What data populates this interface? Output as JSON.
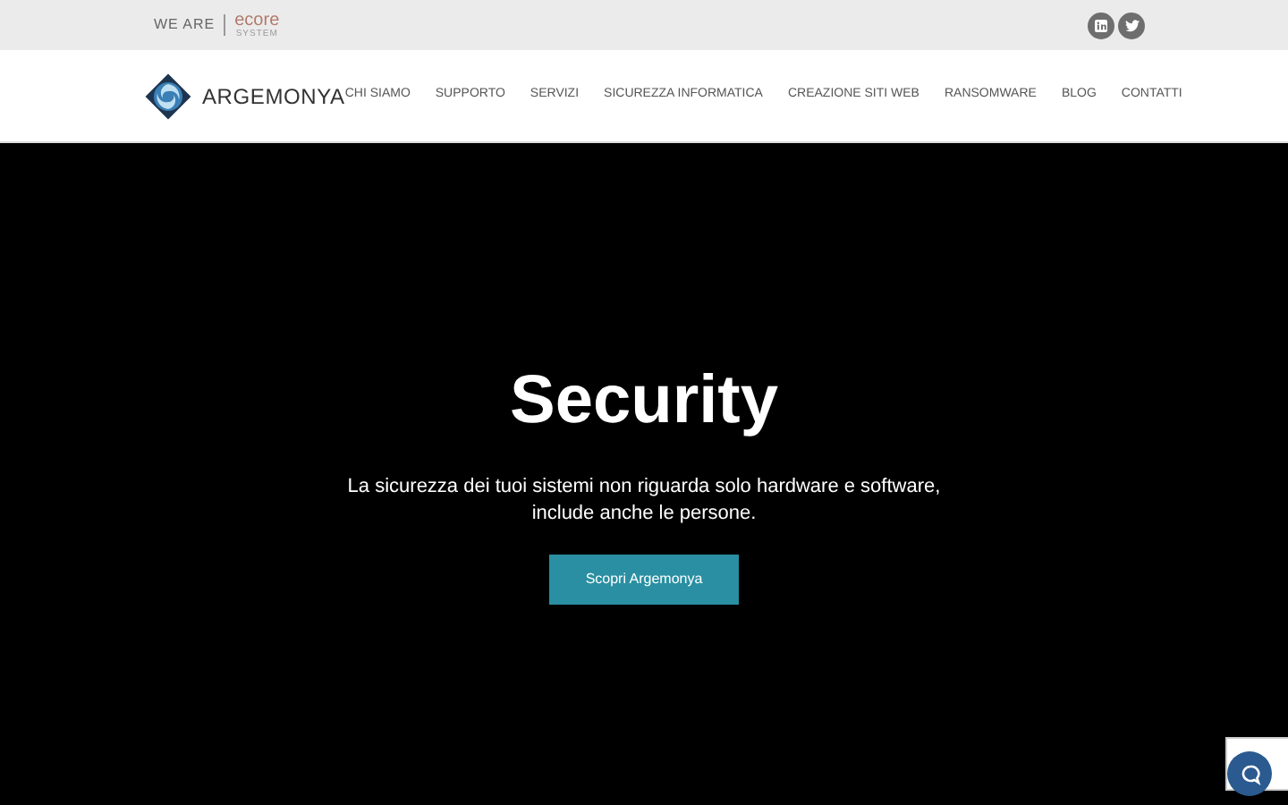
{
  "top_bar": {
    "tagline": "WE ARE",
    "partner_logo": {
      "name": "ecore",
      "subtitle": "SYSTEM"
    }
  },
  "header": {
    "brand": "ARGEMONYA",
    "nav": [
      {
        "label": "CHI SIAMO"
      },
      {
        "label": "SUPPORTO"
      },
      {
        "label": "SERVIZI"
      },
      {
        "label": "SICUREZZA INFORMATICA"
      },
      {
        "label": "CREAZIONE SITI WEB"
      },
      {
        "label": "RANSOMWARE"
      },
      {
        "label": "BLOG"
      },
      {
        "label": "CONTATTI"
      }
    ]
  },
  "hero": {
    "title": "Security",
    "subtitle_lines": [
      "La sicurezza dei tuoi sistemi non riguarda solo hardware e software,",
      "include anche le persone."
    ],
    "button": "Scopri Argemonya"
  }
}
